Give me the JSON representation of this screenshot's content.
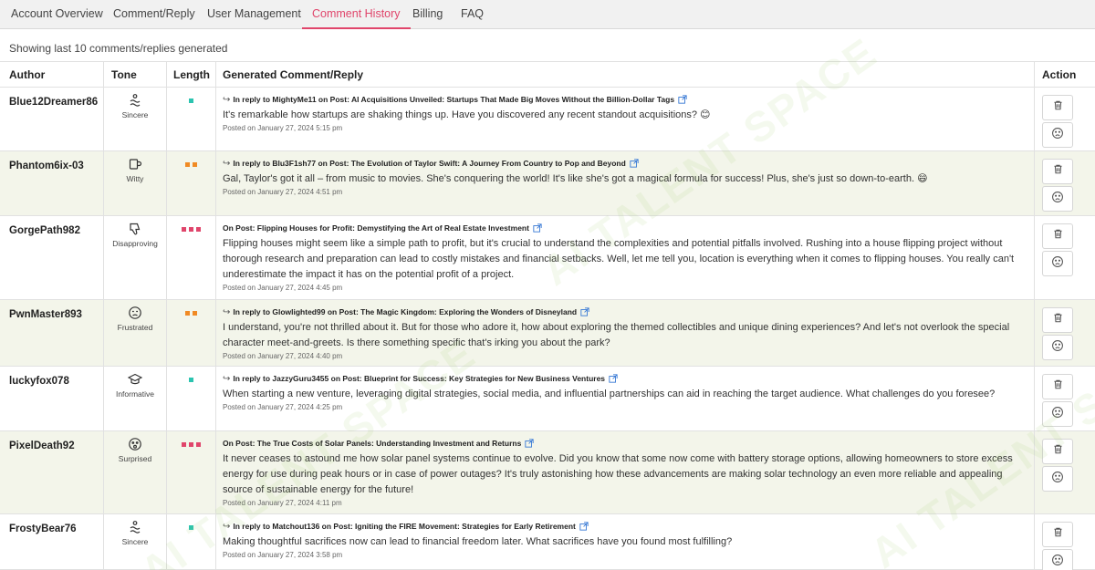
{
  "tabs": [
    {
      "label": "Account Overview",
      "active": false
    },
    {
      "label": "Comment/Reply",
      "active": false
    },
    {
      "label": "User Management",
      "active": false
    },
    {
      "label": "Comment History",
      "active": true
    },
    {
      "label": "Billing",
      "active": false
    },
    {
      "label": "FAQ",
      "active": false
    }
  ],
  "caption": "Showing last 10 comments/replies generated",
  "columns": {
    "author": "Author",
    "tone": "Tone",
    "length": "Length",
    "generated": "Generated Comment/Reply",
    "action": "Action"
  },
  "watermark": "AI TALENT SPACE",
  "colors": {
    "accent": "#e0456b",
    "short": "#2cc4b0",
    "medium": "#f08a24",
    "long": "#e0456b"
  },
  "rows": [
    {
      "author": "Blue12Dreamer86",
      "tone_icon": "wave-icon",
      "tone": "Sincere",
      "length": "short",
      "context": "In reply to MightyMe11 on Post: AI Acquisitions Unveiled: Startups That Made Big Moves Without the Billion-Dollar Tags",
      "is_reply": true,
      "text": "It's remarkable how startups are shaking things up. Have you discovered any recent standout acquisitions? 😊",
      "date": "Posted on January 27, 2024 5:15 pm"
    },
    {
      "author": "Phantom6ix-03",
      "tone_icon": "mug-icon",
      "tone": "Witty",
      "length": "medium",
      "context": "In reply to Blu3F1sh77 on Post: The Evolution of Taylor Swift: A Journey From Country to Pop and Beyond",
      "is_reply": true,
      "text": "Gal, Taylor's got it all – from music to movies. She's conquering the world! It's like she's got a magical formula for success! Plus, she's just so down-to-earth. 😄",
      "date": "Posted on January 27, 2024 4:51 pm"
    },
    {
      "author": "GorgePath982",
      "tone_icon": "thumbs-down-icon",
      "tone": "Disapproving",
      "length": "long",
      "context": "On Post: Flipping Houses for Profit: Demystifying the Art of Real Estate Investment",
      "is_reply": false,
      "text": "Flipping houses might seem like a simple path to profit, but it's crucial to understand the complexities and potential pitfalls involved. Rushing into a house flipping project without thorough research and preparation can lead to costly mistakes and financial setbacks. Well, let me tell you, location is everything when it comes to flipping houses. You really can't underestimate the impact it has on the potential profit of a project.",
      "date": "Posted on January 27, 2024 4:45 pm"
    },
    {
      "author": "PwnMaster893",
      "tone_icon": "frustrated-face-icon",
      "tone": "Frustrated",
      "length": "medium",
      "context": "In reply to Glowlighted99 on Post: The Magic Kingdom: Exploring the Wonders of Disneyland",
      "is_reply": true,
      "text": "I understand, you're not thrilled about it. But for those who adore it, how about exploring the themed collectibles and unique dining experiences? And let's not overlook the special character meet-and-greets. Is there something specific that's irking you about the park?",
      "date": "Posted on January 27, 2024 4:40 pm"
    },
    {
      "author": "luckyfox078",
      "tone_icon": "graduation-cap-icon",
      "tone": "Informative",
      "length": "short",
      "context": "In reply to JazzyGuru3455 on Post: Blueprint for Success: Key Strategies for New Business Ventures",
      "is_reply": true,
      "text": "When starting a new venture, leveraging digital strategies, social media, and influential partnerships can aid in reaching the target audience. What challenges do you foresee?",
      "date": "Posted on January 27, 2024 4:25 pm"
    },
    {
      "author": "PixelDeath92",
      "tone_icon": "surprised-face-icon",
      "tone": "Surprised",
      "length": "long",
      "context": "On Post: The True Costs of Solar Panels: Understanding Investment and Returns",
      "is_reply": false,
      "text": "It never ceases to astound me how solar panel systems continue to evolve. Did you know that some now come with battery storage options, allowing homeowners to store excess energy for use during peak hours or in case of power outages? It's truly astonishing how these advancements are making solar technology an even more reliable and appealing source of sustainable energy for the future!",
      "date": "Posted on January 27, 2024 4:11 pm"
    },
    {
      "author": "FrostyBear76",
      "tone_icon": "wave-icon",
      "tone": "Sincere",
      "length": "short",
      "context": "In reply to Matchout136 on Post: Igniting the FIRE Movement: Strategies for Early Retirement",
      "is_reply": true,
      "text": "Making thoughtful sacrifices now can lead to financial freedom later. What sacrifices have you found most fulfilling?",
      "date": "Posted on January 27, 2024 3:58 pm"
    }
  ]
}
